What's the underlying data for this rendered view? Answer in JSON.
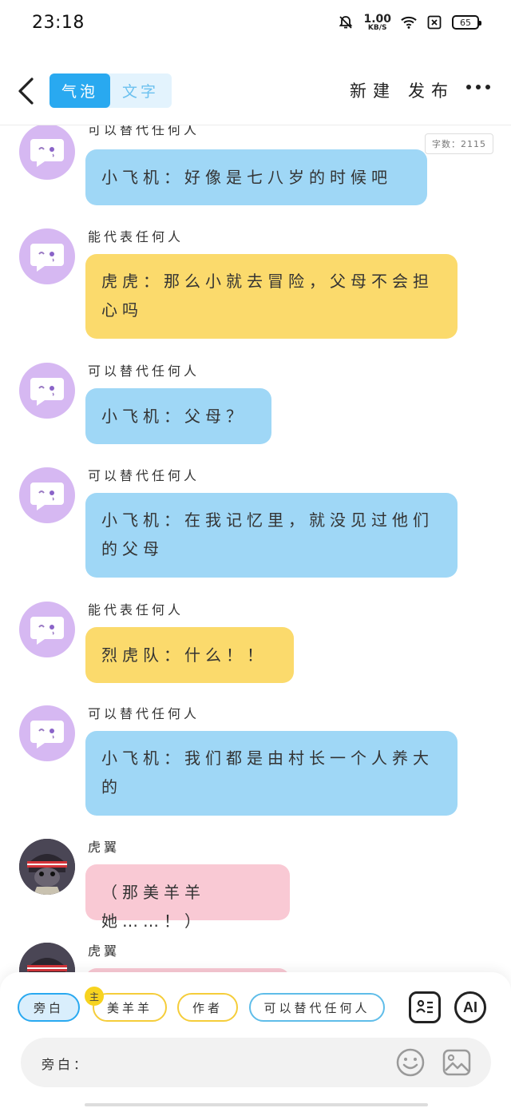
{
  "status_bar": {
    "time": "23:18",
    "net_speed_value": "1.00",
    "net_speed_unit": "KB/S",
    "battery": "65",
    "icons": [
      "bell-off-icon",
      "wifi-icon",
      "sim-off-icon",
      "battery-icon"
    ]
  },
  "header": {
    "back_icon": "chevron-left-icon",
    "tabs": [
      {
        "label": "气泡",
        "active": true
      },
      {
        "label": "文字",
        "active": false
      }
    ],
    "new_label": "新建",
    "publish_label": "发布",
    "more_icon": "more-dots-icon"
  },
  "word_count": "字数：2115",
  "messages": [
    {
      "name": "可以替代任何人",
      "text": "小飞机：好像是七八岁的时候吧",
      "color": "blue",
      "avatar": "chat-bubble-avatar"
    },
    {
      "name": "能代表任何人",
      "text": "虎虎：那么小就去冒险，父母不会担心吗",
      "color": "yellow",
      "avatar": "chat-bubble-avatar"
    },
    {
      "name": "可以替代任何人",
      "text": "小飞机：父母？",
      "color": "blue",
      "avatar": "chat-bubble-avatar"
    },
    {
      "name": "可以替代任何人",
      "text": "小飞机：在我记忆里，就没见过他们的父母",
      "color": "blue",
      "avatar": "chat-bubble-avatar"
    },
    {
      "name": "能代表任何人",
      "text": "烈虎队：什么！！",
      "color": "yellow",
      "avatar": "chat-bubble-avatar"
    },
    {
      "name": "可以替代任何人",
      "text": "小飞机：我们都是由村长一个人养大的",
      "color": "blue",
      "avatar": "chat-bubble-avatar"
    },
    {
      "name": "虎翼",
      "text": "（那美羊羊她……！）",
      "color": "pink",
      "avatar": "character-avatar"
    },
    {
      "name": "虎翼",
      "text": "",
      "color": "pink",
      "avatar": "character-avatar"
    }
  ],
  "roles": {
    "narration": "旁白",
    "main_badge": "主",
    "meiyangyang": "美羊羊",
    "author": "作者",
    "anyone": "可以替代任何人"
  },
  "tools": {
    "card_icon": "contact-card-icon",
    "ai_label": "AI"
  },
  "input": {
    "label": "旁白："
  },
  "colors": {
    "accent_blue": "#29a9f0",
    "bubble_blue": "#9fd7f6",
    "bubble_yellow": "#fbda6c",
    "bubble_pink": "#f9c9d4",
    "avatar_purple": "#d6b8f2"
  }
}
